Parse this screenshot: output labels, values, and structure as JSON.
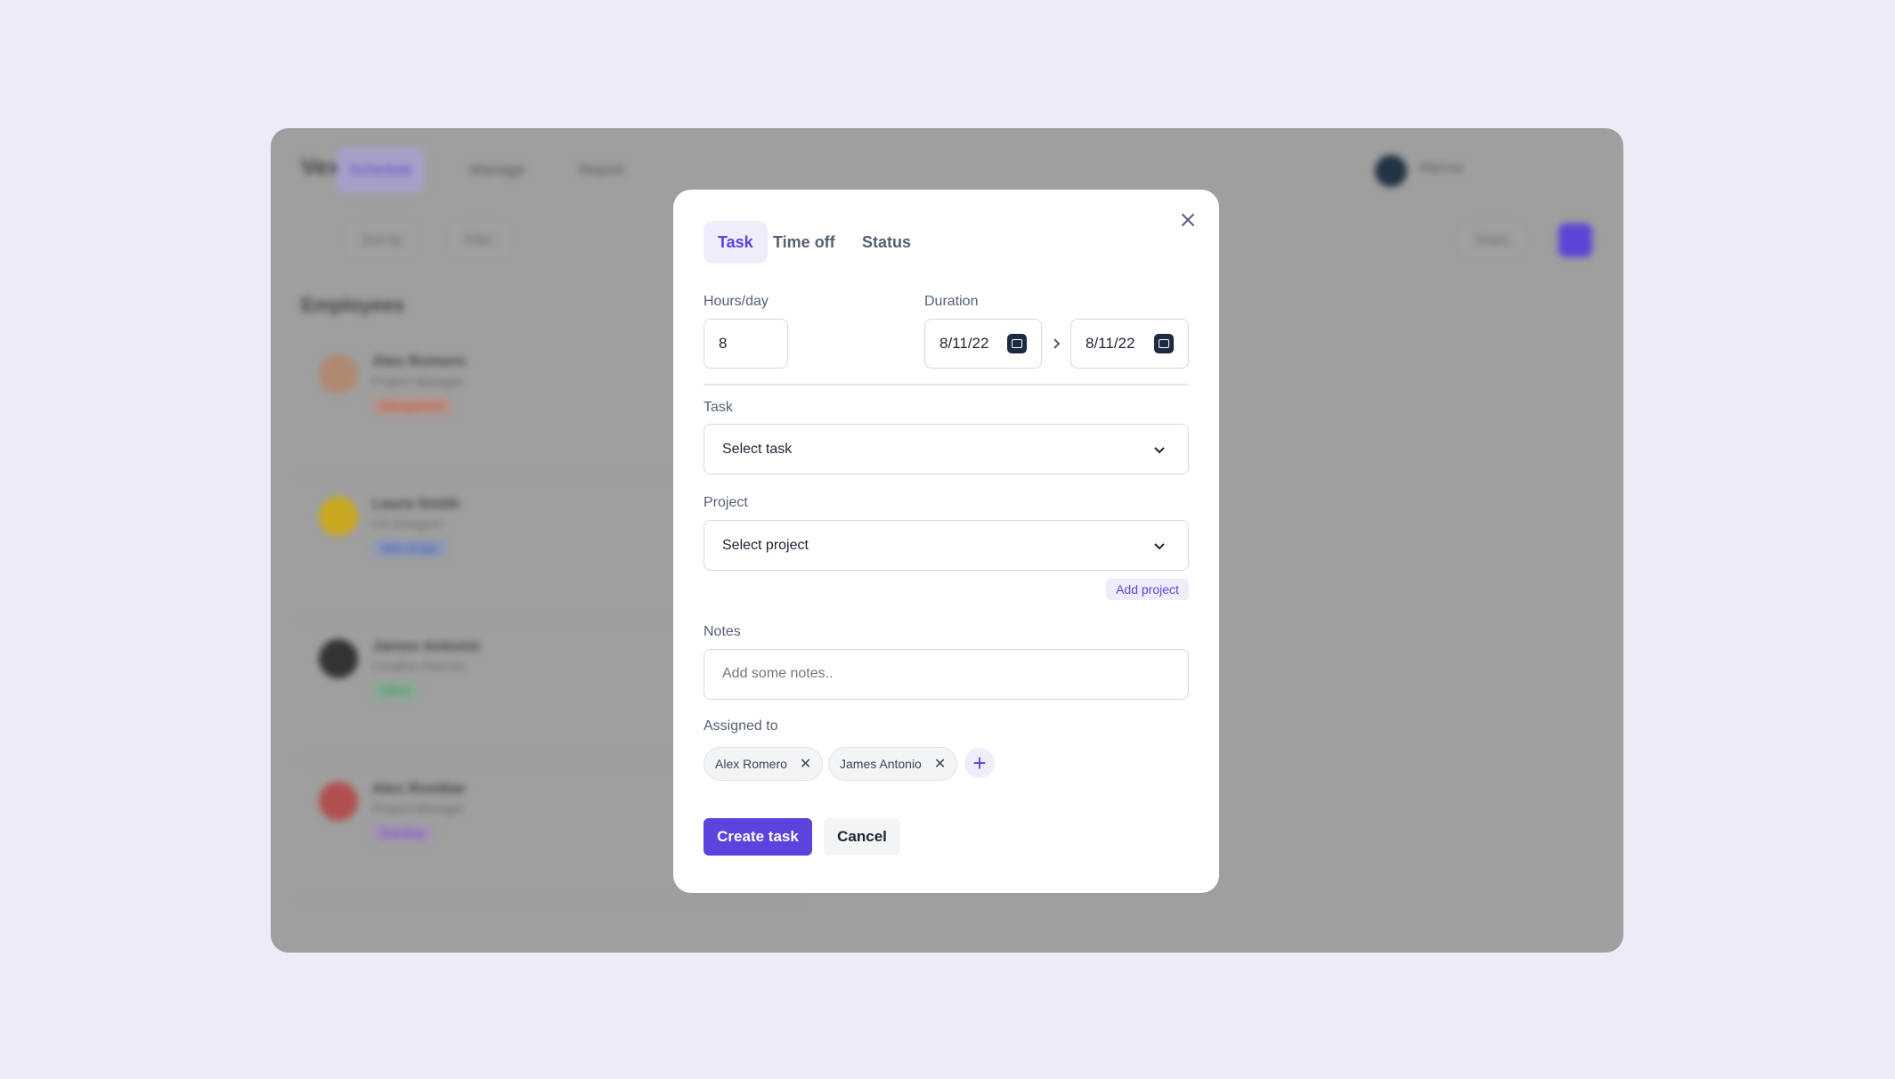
{
  "background_app": {
    "brand": "Vexsphere",
    "nav": [
      "Schedule",
      "Manage",
      "Report"
    ],
    "user": "Marcus",
    "toolbar": {
      "sort": "Sort by",
      "filter": "Filter",
      "share": "Share"
    },
    "employees_title": "Employees",
    "employees": [
      {
        "name": "Alex Romero",
        "role": "Project Manager",
        "tag": "Management",
        "tag_color": "#e07a5f"
      },
      {
        "name": "Laura Smith",
        "role": "UX Designer",
        "tag": "Web design",
        "tag_color": "#6b8ee0"
      },
      {
        "name": "James Antonio",
        "role": "Creative Director",
        "tag": "UI/UX",
        "tag_color": "#5fbf85"
      },
      {
        "name": "Alex Rombar",
        "role": "Project Manager",
        "tag": "Branding",
        "tag_color": "#a77ee0"
      }
    ]
  },
  "modal": {
    "tabs": [
      {
        "label": "Task",
        "active": true
      },
      {
        "label": "Time off",
        "active": false
      },
      {
        "label": "Status",
        "active": false
      }
    ],
    "hours_label": "Hours/day",
    "hours_value": "8",
    "duration_label": "Duration",
    "start_date": "8/11/22",
    "end_date": "8/11/22",
    "task_label": "Task",
    "task_placeholder": "Select task",
    "project_label": "Project",
    "project_placeholder": "Select project",
    "add_project": "Add project",
    "notes_label": "Notes",
    "notes_placeholder": "Add some notes..",
    "assigned_label": "Assigned to",
    "assignees": [
      "Alex Romero",
      "James Antonio"
    ],
    "create_button": "Create task",
    "cancel_button": "Cancel",
    "accent_color": "#5B43DD"
  }
}
